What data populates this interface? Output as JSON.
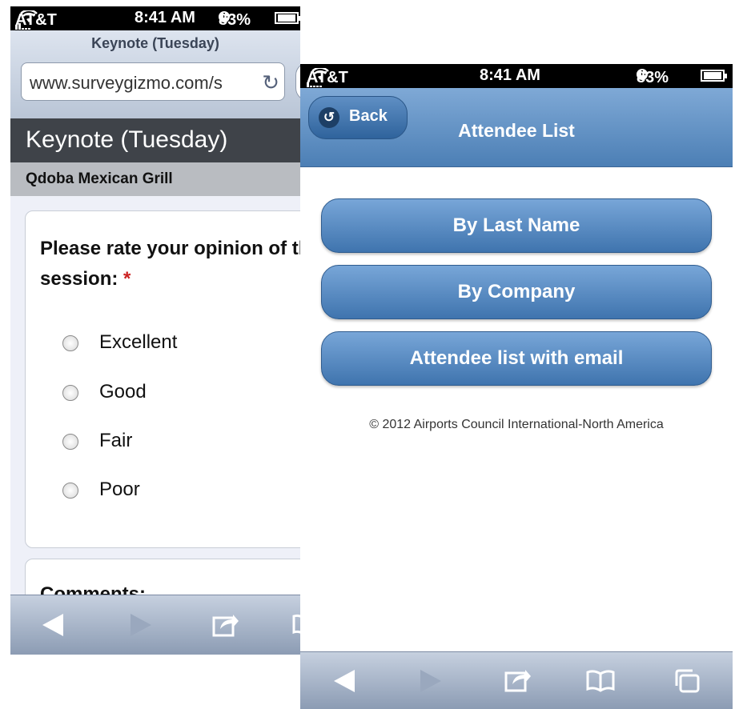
{
  "left_screen": {
    "status": {
      "carrier": "AT&T",
      "time": "8:41 AM",
      "battery": "83%"
    },
    "page_title": "Keynote (Tuesday)",
    "url": "www.surveygizmo.com/s",
    "header": "Keynote (Tuesday)",
    "subheader": "Qdoba Mexican Grill",
    "question": {
      "text": "Please rate your opinion of this session:",
      "required_mark": "*"
    },
    "options": [
      "Excellent",
      "Good",
      "Fair",
      "Poor"
    ],
    "comments_label": "Comments:"
  },
  "right_screen": {
    "status": {
      "carrier": "AT&T",
      "time": "8:41 AM",
      "battery": "83%"
    },
    "back_label": "Back",
    "title": "Attendee List",
    "buttons": [
      "By Last Name",
      "By Company",
      "Attendee list with email"
    ],
    "footer": "© 2012 Airports Council International-North America"
  },
  "icons": {
    "back": "back-arrow-icon",
    "forward": "forward-arrow-icon",
    "share": "share-icon",
    "bookmarks": "bookmarks-icon",
    "tabs": "tabs-icon",
    "reload": "reload-icon",
    "wifi": "wifi-icon",
    "alarm": "alarm-clock-icon",
    "battery": "battery-charging-icon"
  },
  "colors": {
    "nav_blue": "#4c7fb5",
    "button_blue": "#5b8dc4",
    "header_dark": "#3f4349",
    "required_red": "#cc2222"
  }
}
